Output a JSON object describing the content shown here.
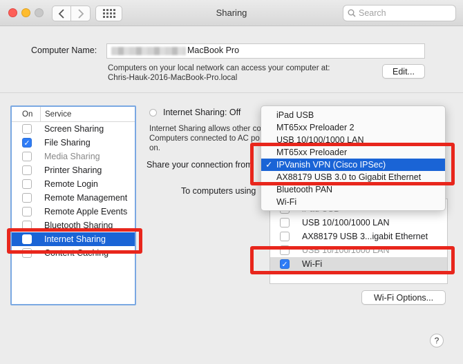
{
  "window": {
    "title": "Sharing",
    "search_placeholder": "Search"
  },
  "computer": {
    "name_label": "Computer Name:",
    "name_value": "MacBook Pro",
    "access_note": "Computers on your local network can access your computer at:",
    "local_address": "Chris-Hauk-2016-MacBook-Pro.local",
    "edit_label": "Edit..."
  },
  "services": {
    "header_on": "On",
    "header_service": "Service",
    "items": [
      {
        "label": "Screen Sharing",
        "checked": false
      },
      {
        "label": "File Sharing",
        "checked": true
      },
      {
        "label": "Media Sharing",
        "checked": false
      },
      {
        "label": "Printer Sharing",
        "checked": false
      },
      {
        "label": "Remote Login",
        "checked": false
      },
      {
        "label": "Remote Management",
        "checked": false
      },
      {
        "label": "Remote Apple Events",
        "checked": false
      },
      {
        "label": "Bluetooth Sharing",
        "checked": false
      },
      {
        "label": "Internet Sharing",
        "checked": false,
        "selected": true
      },
      {
        "label": "Content Caching",
        "checked": false
      }
    ]
  },
  "internet_sharing": {
    "status": "Internet Sharing: Off",
    "desc_line1": "Internet Sharing allows other co",
    "desc_line2": "Computers connected to AC po",
    "desc_line3": "on.",
    "share_from_label": "Share your connection from",
    "to_computers_label": "To computers using"
  },
  "menu": {
    "check_glyph": "✓",
    "items": [
      {
        "label": "iPad USB"
      },
      {
        "label": "MT65xx Preloader 2"
      },
      {
        "label": "USB 10/100/1000 LAN"
      },
      {
        "label": "MT65xx Preloader"
      },
      {
        "label": "IPVanish VPN (Cisco IPSec)",
        "selected": true
      },
      {
        "label": "AX88179 USB 3.0 to Gigabit Ethernet"
      },
      {
        "label": "Bluetooth PAN"
      },
      {
        "label": "Wi-Fi"
      }
    ]
  },
  "ports": {
    "items": [
      {
        "label": "iPad USB",
        "checked": false,
        "ghost": true
      },
      {
        "label": "USB 10/100/1000 LAN",
        "checked": false
      },
      {
        "label": "AX88179 USB 3...igabit Ethernet",
        "checked": false
      },
      {
        "label": "USB 10/100/1000 LAN",
        "checked": false,
        "ghost": true
      },
      {
        "label": "Wi-Fi",
        "checked": true,
        "selected": true
      }
    ],
    "wifi_options_label": "Wi-Fi Options..."
  },
  "help": {
    "label": "?"
  },
  "colors": {
    "highlight_red": "#e8261c",
    "selection_blue": "#1a64d6",
    "checkbox_blue": "#2f7cf6"
  }
}
